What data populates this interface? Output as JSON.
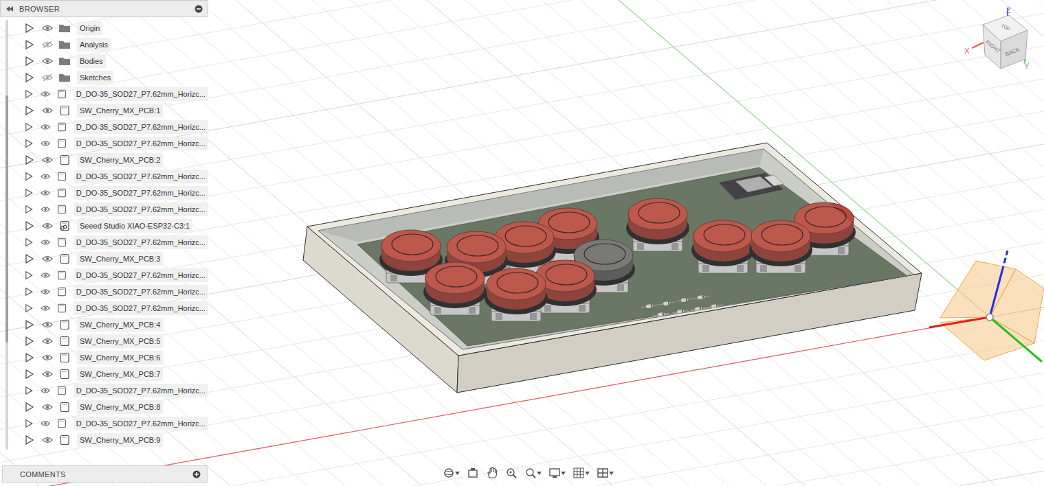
{
  "browser": {
    "title": "BROWSER",
    "items": [
      {
        "label": "Origin",
        "visible": true,
        "kind": "folder",
        "expanded": false
      },
      {
        "label": "Analysis",
        "visible": false,
        "kind": "folder",
        "expanded": false
      },
      {
        "label": "Bodies",
        "visible": true,
        "kind": "folder",
        "expanded": false
      },
      {
        "label": "Sketches",
        "visible": false,
        "kind": "folder",
        "expanded": false
      },
      {
        "label": "D_DO-35_SOD27_P7.62mm_Horizc...",
        "visible": true,
        "kind": "component",
        "expanded": false
      },
      {
        "label": "SW_Cherry_MX_PCB:1",
        "visible": true,
        "kind": "component",
        "expanded": false
      },
      {
        "label": "D_DO-35_SOD27_P7.62mm_Horizc...",
        "visible": true,
        "kind": "component",
        "expanded": false
      },
      {
        "label": "D_DO-35_SOD27_P7.62mm_Horizc...",
        "visible": true,
        "kind": "component",
        "expanded": false
      },
      {
        "label": "SW_Cherry_MX_PCB:2",
        "visible": true,
        "kind": "component",
        "expanded": false
      },
      {
        "label": "D_DO-35_SOD27_P7.62mm_Horizc...",
        "visible": true,
        "kind": "component",
        "expanded": false
      },
      {
        "label": "D_DO-35_SOD27_P7.62mm_Horizc...",
        "visible": true,
        "kind": "component",
        "expanded": false
      },
      {
        "label": "D_DO-35_SOD27_P7.62mm_Horizc...",
        "visible": true,
        "kind": "component",
        "expanded": false
      },
      {
        "label": "Seeed Studio XIAO-ESP32-C3:1",
        "visible": true,
        "kind": "linked",
        "expanded": false
      },
      {
        "label": "D_DO-35_SOD27_P7.62mm_Horizc...",
        "visible": true,
        "kind": "component",
        "expanded": false
      },
      {
        "label": "SW_Cherry_MX_PCB:3",
        "visible": true,
        "kind": "component",
        "expanded": false
      },
      {
        "label": "D_DO-35_SOD27_P7.62mm_Horizc...",
        "visible": true,
        "kind": "component",
        "expanded": false
      },
      {
        "label": "D_DO-35_SOD27_P7.62mm_Horizc...",
        "visible": true,
        "kind": "component",
        "expanded": false
      },
      {
        "label": "D_DO-35_SOD27_P7.62mm_Horizc...",
        "visible": true,
        "kind": "component",
        "expanded": false
      },
      {
        "label": "SW_Cherry_MX_PCB:4",
        "visible": true,
        "kind": "component",
        "expanded": false
      },
      {
        "label": "SW_Cherry_MX_PCB:5",
        "visible": true,
        "kind": "component",
        "expanded": false
      },
      {
        "label": "SW_Cherry_MX_PCB:6",
        "visible": true,
        "kind": "component",
        "expanded": false
      },
      {
        "label": "SW_Cherry_MX_PCB:7",
        "visible": true,
        "kind": "component",
        "expanded": false
      },
      {
        "label": "D_DO-35_SOD27_P7.62mm_Horizc...",
        "visible": true,
        "kind": "component",
        "expanded": false
      },
      {
        "label": "SW_Cherry_MX_PCB:8",
        "visible": true,
        "kind": "component",
        "expanded": false
      },
      {
        "label": "D_DO-35_SOD27_P7.62mm_Horizc...",
        "visible": true,
        "kind": "component",
        "expanded": false
      },
      {
        "label": "SW_Cherry_MX_PCB:9",
        "visible": true,
        "kind": "component",
        "expanded": false
      }
    ]
  },
  "comments": {
    "title": "COMMENTS"
  },
  "viewcube": {
    "faces": [
      "TOP",
      "RIGHT",
      "BACK"
    ],
    "axes": {
      "x": "X",
      "y": "Y",
      "z": "Z"
    }
  },
  "model": {
    "buttons": [
      {
        "color": "#b84a3e"
      },
      {
        "color": "#b84a3e"
      },
      {
        "color": "#b84a3e"
      },
      {
        "color": "#b84a3e"
      },
      {
        "color": "#b84a3e"
      },
      {
        "color": "#b84a3e"
      },
      {
        "color": "#b84a3e"
      },
      {
        "color": "#b84a3e"
      },
      {
        "color": "#b84a3e"
      },
      {
        "color": "#b84a3e"
      },
      {
        "color": "#b84a3e"
      },
      {
        "color": "#6e6e6c"
      }
    ]
  }
}
